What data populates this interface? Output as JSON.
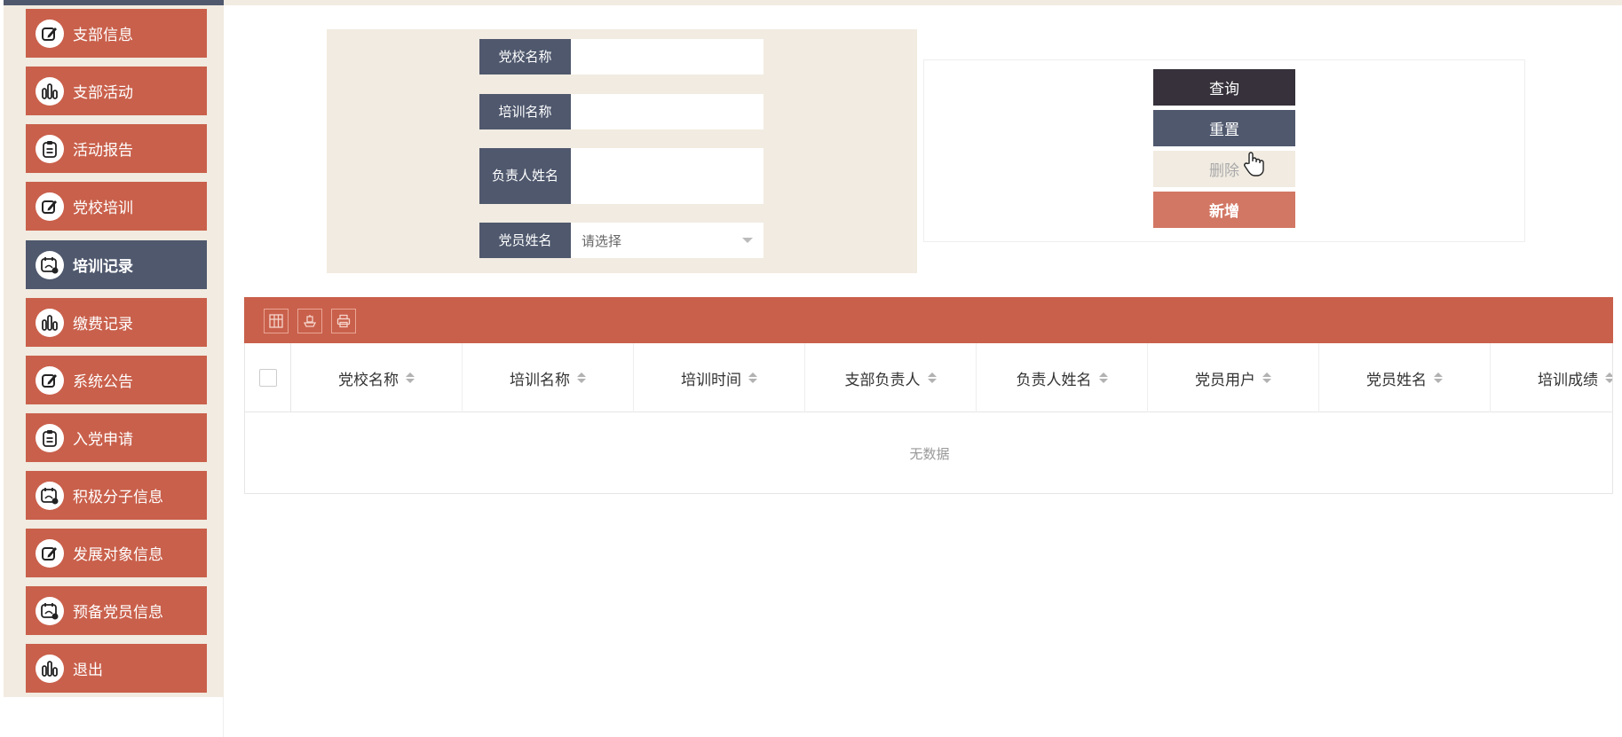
{
  "sidebar": {
    "items": [
      {
        "label": "支部信息",
        "icon": "edit-icon"
      },
      {
        "label": "支部活动",
        "icon": "bar-chart-icon"
      },
      {
        "label": "活动报告",
        "icon": "clipboard-icon"
      },
      {
        "label": "党校培训",
        "icon": "edit-icon"
      },
      {
        "label": "培训记录",
        "icon": "calendar-icon",
        "active": true
      },
      {
        "label": "缴费记录",
        "icon": "bar-chart-icon"
      },
      {
        "label": "系统公告",
        "icon": "edit-icon"
      },
      {
        "label": "入党申请",
        "icon": "clipboard-icon"
      },
      {
        "label": "积极分子信息",
        "icon": "calendar-icon"
      },
      {
        "label": "发展对象信息",
        "icon": "edit-icon"
      },
      {
        "label": "预备党员信息",
        "icon": "calendar-icon"
      },
      {
        "label": "退出",
        "icon": "bar-chart-icon"
      }
    ]
  },
  "search": {
    "school_name_label": "党校名称",
    "school_name_value": "",
    "training_name_label": "培训名称",
    "training_name_value": "",
    "leader_name_label": "负责人姓名",
    "leader_name_value": "",
    "member_name_label": "党员姓名",
    "member_name_placeholder": "请选择"
  },
  "buttons": {
    "query": "查询",
    "reset": "重置",
    "delete": "删除",
    "add": "新增"
  },
  "toolbar": {
    "icons": [
      "columns-icon",
      "export-icon",
      "print-icon"
    ]
  },
  "table": {
    "columns": [
      "党校名称",
      "培训名称",
      "培训时间",
      "支部负责人",
      "负责人姓名",
      "党员用户",
      "党员姓名",
      "培训成绩"
    ],
    "empty_text": "无数据"
  },
  "colors": {
    "accent": "#c9604b",
    "dark": "#4f586d",
    "query": "#36313a",
    "add": "#d27764",
    "panel": "#f1ebe1"
  }
}
